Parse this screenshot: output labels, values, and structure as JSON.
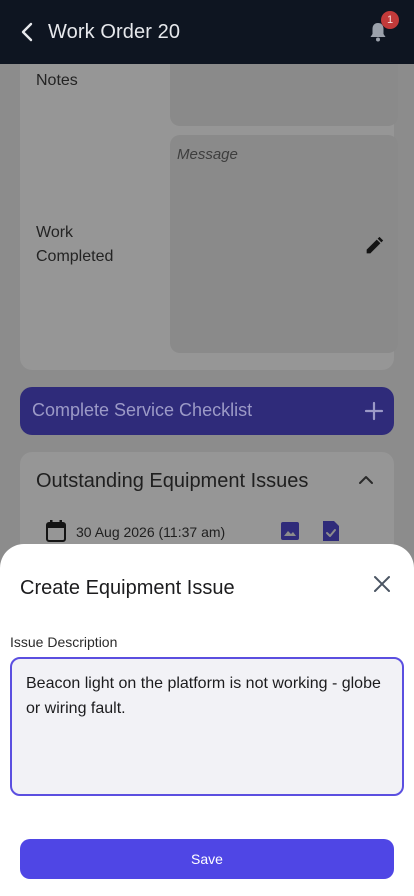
{
  "header": {
    "title": "Work Order 20",
    "notification_count": "1",
    "back_icon": "chevron-left-icon",
    "bell_icon": "bell-icon"
  },
  "form": {
    "notes_label": "Notes",
    "work_completed_label_line1": "Work",
    "work_completed_label_line2": "Completed",
    "message_placeholder": "Message",
    "edit_icon": "pencil-icon"
  },
  "checklist": {
    "label": "Complete Service Checklist",
    "icon": "plus-icon"
  },
  "issues": {
    "title": "Outstanding Equipment Issues",
    "items": [
      {
        "date": "30 Aug 2026 (11:37 am)"
      }
    ]
  },
  "sheet": {
    "title": "Create Equipment Issue",
    "description_label": "Issue Description",
    "description_value": "Beacon light on the platform is not working - globe or wiring fault.",
    "save_label": "Save"
  },
  "colors": {
    "header_bg": "#0e1521",
    "accent": "#4f46e5",
    "badge": "#c23a3a"
  }
}
